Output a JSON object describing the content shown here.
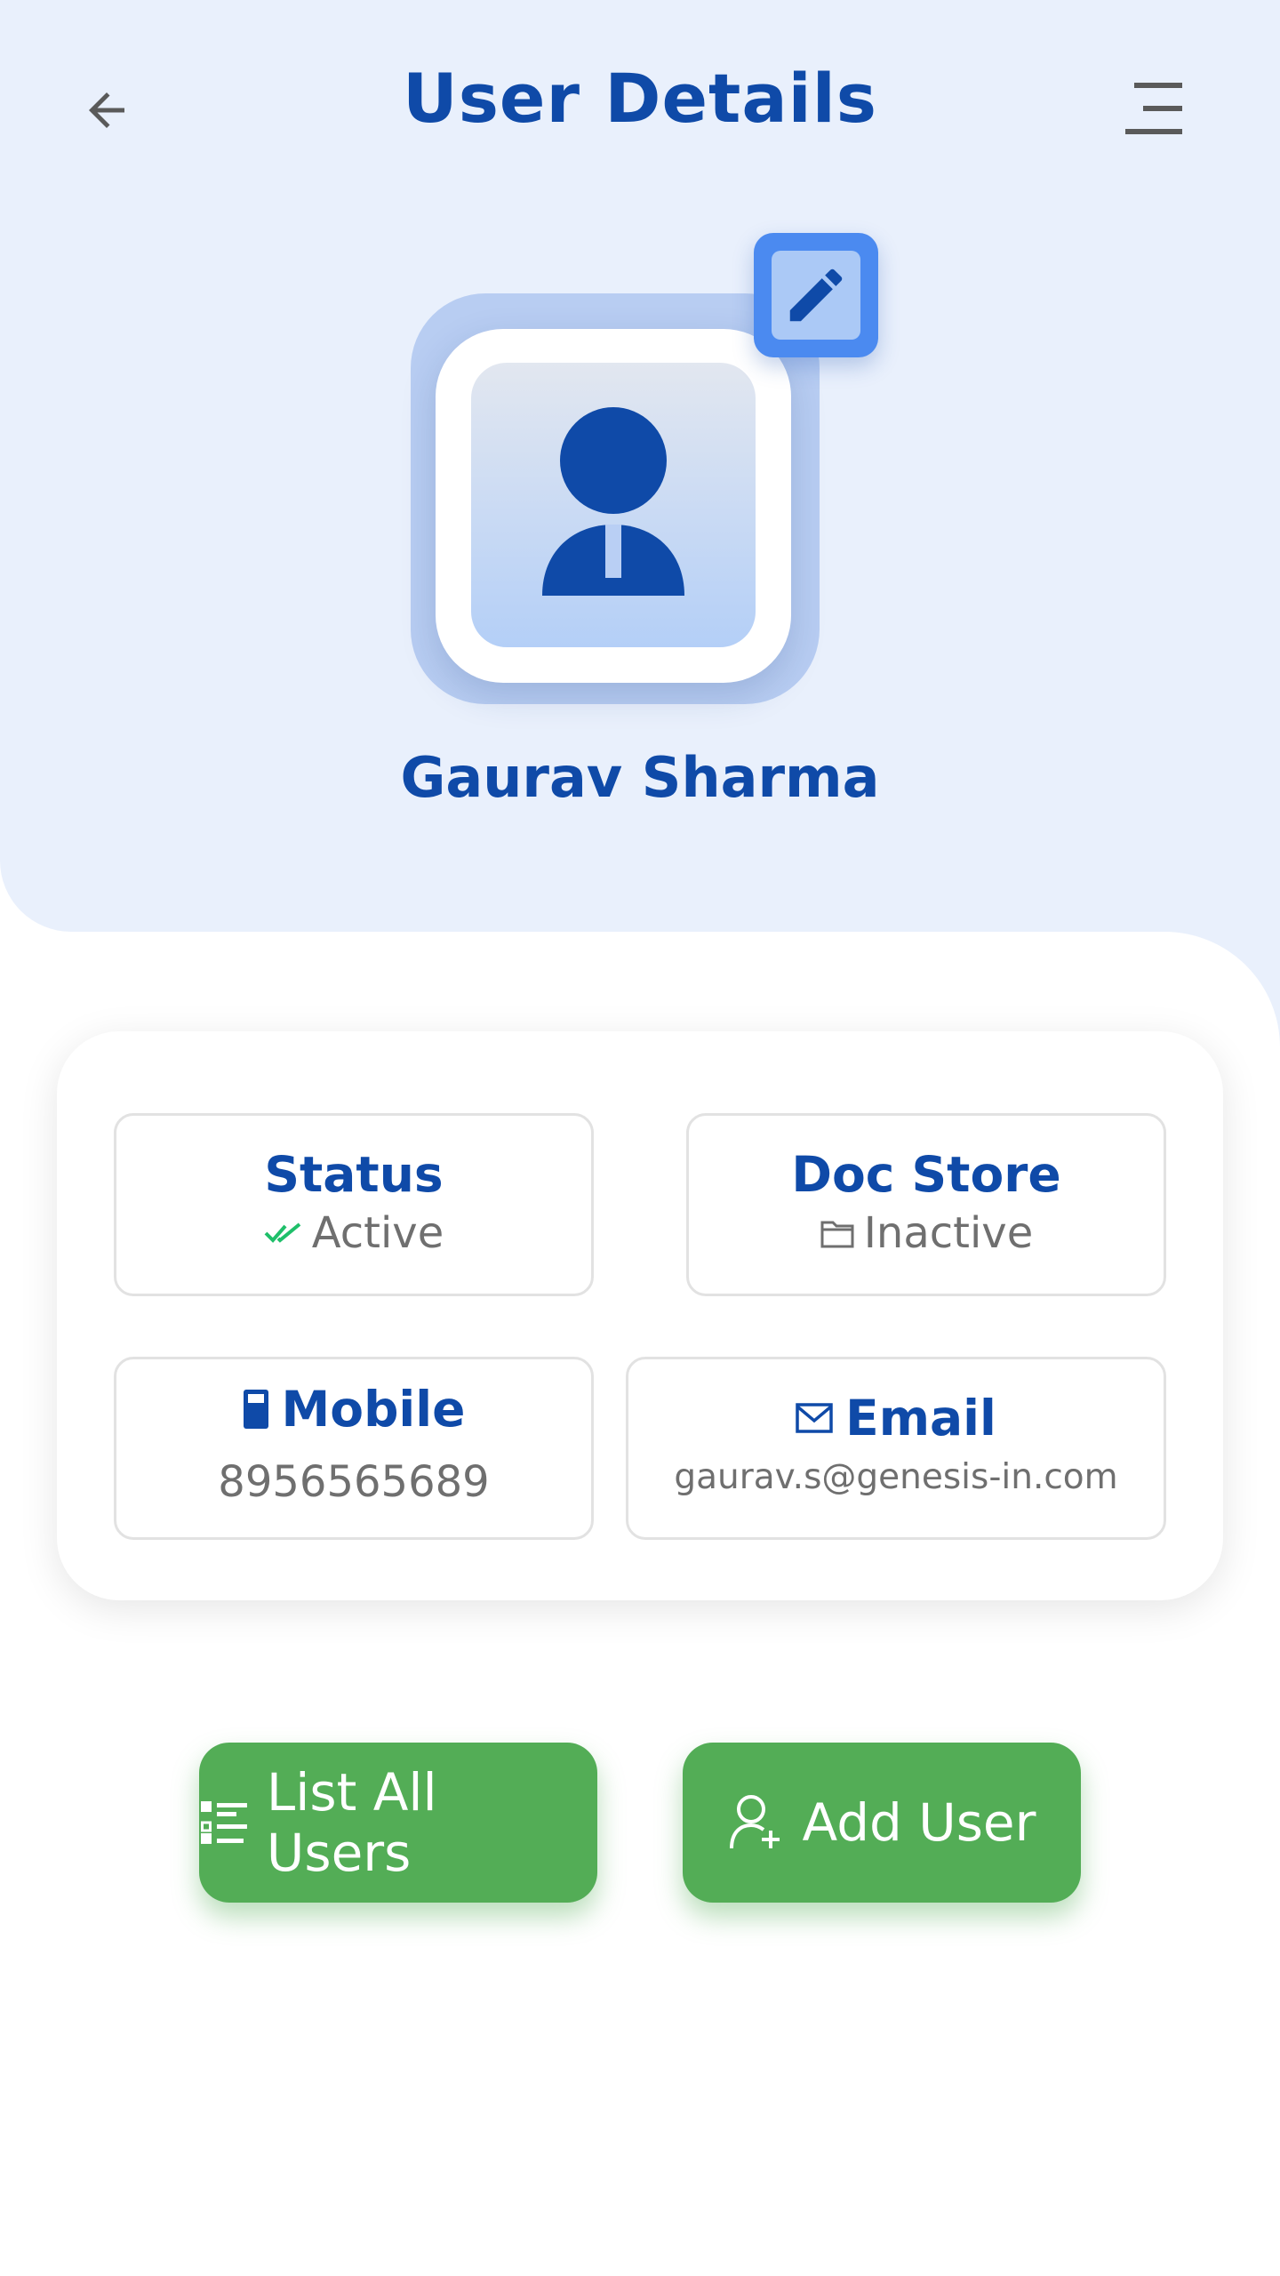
{
  "header": {
    "title": "User Details",
    "back_icon": "arrow-left-icon",
    "menu_icon": "menu-icon"
  },
  "profile": {
    "name": "Gaurav Sharma",
    "avatar_icon": "user-avatar-icon",
    "edit_icon": "pencil-icon"
  },
  "details": {
    "status": {
      "title": "Status",
      "value": "Active",
      "icon": "double-check-icon"
    },
    "doc_store": {
      "title": "Doc Store",
      "value": "Inactive",
      "icon": "folder-icon"
    },
    "mobile": {
      "title": "Mobile",
      "value": "8956565689",
      "icon": "mobile-phone-icon"
    },
    "email": {
      "title": "Email",
      "value": "gaurav.s@genesis-in.com",
      "icon": "mail-icon"
    }
  },
  "actions": {
    "list_all_users": {
      "label": "List All Users",
      "icon": "list-icon"
    },
    "add_user": {
      "label": "Add User",
      "icon": "user-plus-icon"
    }
  },
  "colors": {
    "primary": "#0f4aa8",
    "header_bg": "#e9f0fc",
    "accent_blue": "#4b8af0",
    "success_green": "#53ad56",
    "check_green": "#1fbf6a",
    "muted_text": "#6f6f6f"
  }
}
